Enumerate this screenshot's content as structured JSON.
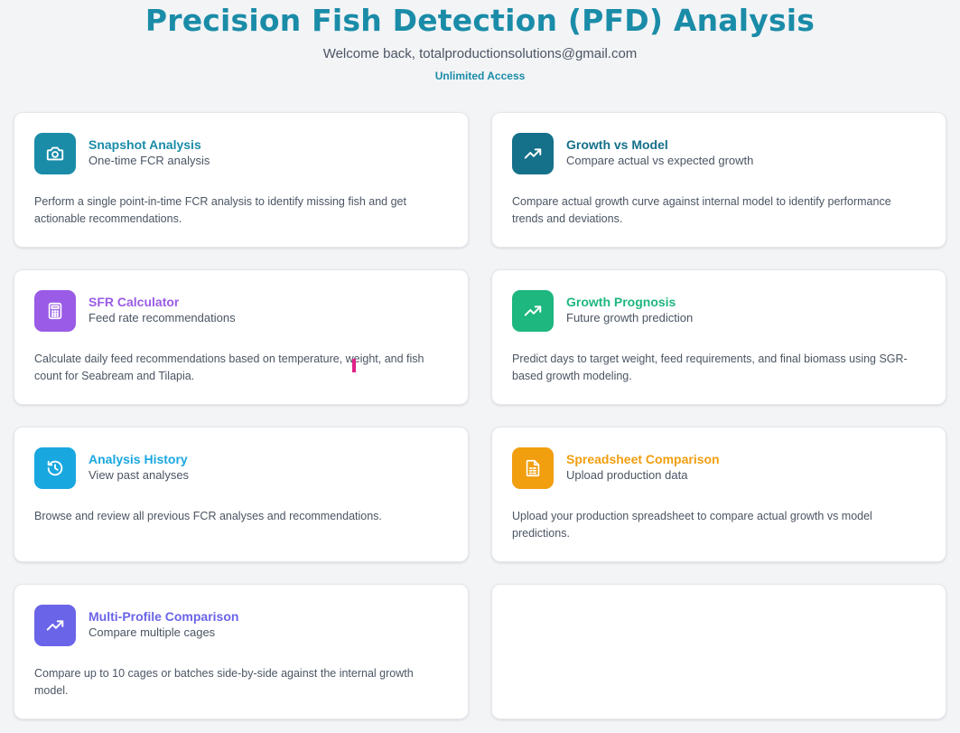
{
  "header": {
    "title": "Precision Fish Detection (PFD) Analysis",
    "welcome": "Welcome back, totalproductionsolutions@gmail.com",
    "access": "Unlimited Access"
  },
  "cards": [
    {
      "title": "Snapshot Analysis",
      "subtitle": "One-time FCR analysis",
      "description": "Perform a single point-in-time FCR analysis to identify missing fish and get actionable recommendations.",
      "icon": "camera-icon",
      "color": "#1a8ca8"
    },
    {
      "title": "Growth vs Model",
      "subtitle": "Compare actual vs expected growth",
      "description": "Compare actual growth curve against internal model to identify performance trends and deviations.",
      "icon": "trending-up-icon",
      "color": "#15708a"
    },
    {
      "title": "SFR Calculator",
      "subtitle": "Feed rate recommendations",
      "description": "Calculate daily feed recommendations based on temperature, weight, and fish count for Seabream and Tilapia.",
      "icon": "calculator-icon",
      "color": "#9a5ce6"
    },
    {
      "title": "Growth Prognosis",
      "subtitle": "Future growth prediction",
      "description": "Predict days to target weight, feed requirements, and final biomass using SGR-based growth modeling.",
      "icon": "trending-up-icon",
      "color": "#1db77f"
    },
    {
      "title": "Analysis History",
      "subtitle": "View past analyses",
      "description": "Browse and review all previous FCR analyses and recommendations.",
      "icon": "history-icon",
      "color": "#19a7e0"
    },
    {
      "title": "Spreadsheet Comparison",
      "subtitle": "Upload production data",
      "description": "Upload your production spreadsheet to compare actual growth vs model predictions.",
      "icon": "spreadsheet-icon",
      "color": "#f19e0f"
    },
    {
      "title": "Multi-Profile Comparison",
      "subtitle": "Compare multiple cages",
      "description": "Compare up to 10 cages or batches side-by-side against the internal growth model.",
      "icon": "trending-up-icon",
      "color": "#6a64e8"
    }
  ]
}
